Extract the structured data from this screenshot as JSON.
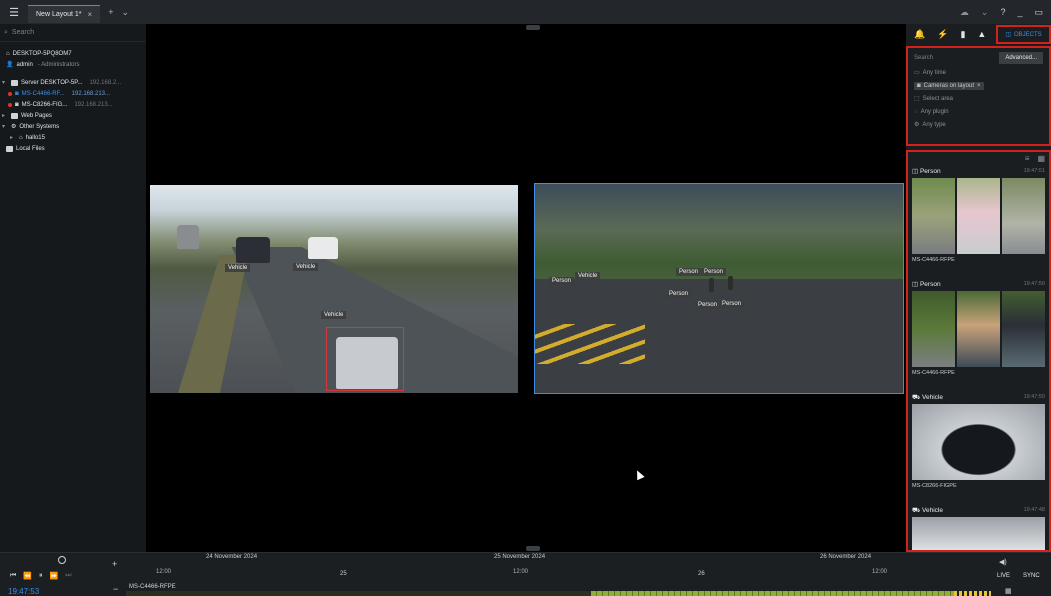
{
  "titlebar": {
    "tab_label": "New Layout 1*",
    "tab_close": "×",
    "tab_add": "+",
    "tab_more": "⌄",
    "help": "?",
    "minimize": "_",
    "restore": "▭"
  },
  "left": {
    "search_placeholder": "Search",
    "tree": [
      {
        "label": "DESKTOP-5PQ8OM7",
        "ip": "",
        "icon": "monitor-icon"
      },
      {
        "label": "admin",
        "ip": "- Administrators",
        "icon": "user-icon"
      },
      {
        "label": "Server DESKTOP-5P...",
        "ip": "192.168.2...",
        "icon": "server-icon"
      },
      {
        "label": "MS-C4466-RF...",
        "ip": "192.168.213...",
        "icon": "camera-icon",
        "selected": true
      },
      {
        "label": "MS-C8266-FIG...",
        "ip": "192.168.213...",
        "icon": "camera-icon"
      },
      {
        "label": "Web Pages",
        "ip": "",
        "icon": "web-icon"
      },
      {
        "label": "Other Systems",
        "ip": "",
        "icon": "systems-icon"
      },
      {
        "label": "hallo15",
        "ip": "",
        "icon": "home-icon"
      },
      {
        "label": "Local Files",
        "ip": "",
        "icon": "folder-icon"
      }
    ]
  },
  "viewport": {
    "left_labels": [
      "Vehicle",
      "Vehicle",
      "Vehicle"
    ],
    "right_labels": [
      "Person",
      "Vehicle",
      "Person",
      "Person",
      "Person",
      "Person",
      "Person"
    ]
  },
  "right": {
    "objects_tab": "OBJECTS",
    "search_placeholder": "Search",
    "advanced": "Advanced...",
    "filters": [
      "Any time",
      "Cameras on layout",
      "Select area",
      "Any plugin",
      "Any type"
    ],
    "tiles": [
      {
        "type": "Person",
        "time": "19:47:51",
        "camera": "MS-C4466-RFPE"
      },
      {
        "type": "Person",
        "time": "19:47:50",
        "camera": "MS-C4466-RFPE"
      },
      {
        "type": "Vehicle",
        "time": "19:47:50",
        "camera": "MS-C8266-FIGPE"
      },
      {
        "type": "Vehicle",
        "time": "19:47:48",
        "camera": ""
      }
    ]
  },
  "timeline": {
    "dates": [
      "24 November 2024",
      "25 November 2024",
      "26 November 2024"
    ],
    "major_hours": [
      "12:00",
      "12:00",
      "12:00"
    ],
    "day_numbers": [
      "25",
      "26"
    ],
    "camera": "MS-C4466-RFPE",
    "clock": "19:47:53",
    "live": "LIVE",
    "sync": "SYNC",
    "zoom_in": "+",
    "zoom_out": "−"
  },
  "colors": {
    "accent": "#3c8ee6",
    "highlight_border": "#d3221b",
    "archive_fill": "#8fae3a",
    "record_mark": "#e7c63a"
  }
}
